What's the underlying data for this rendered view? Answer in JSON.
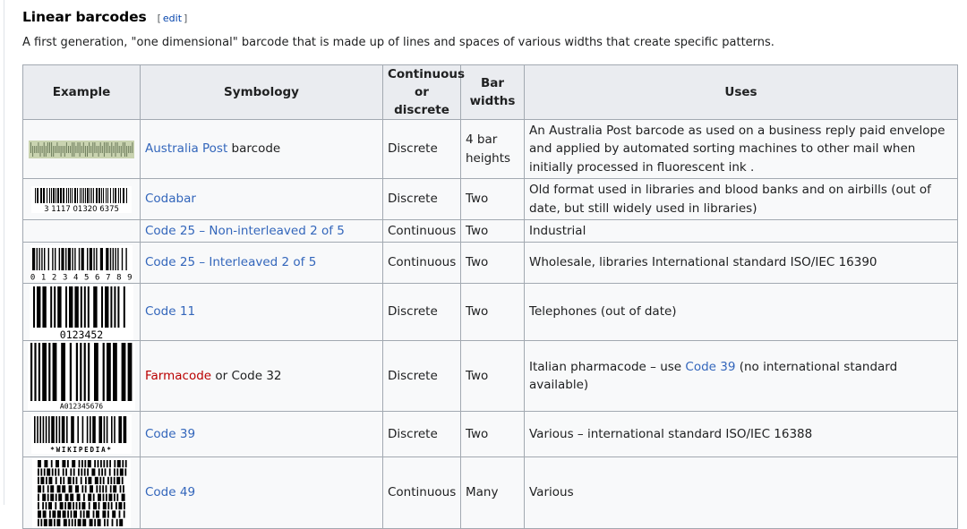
{
  "section": {
    "title": "Linear barcodes",
    "edit_open": "[",
    "edit_label": "edit",
    "edit_close": "]",
    "intro": "A first generation, \"one dimensional\" barcode that is made up of lines and spaces of various widths that create specific patterns."
  },
  "table": {
    "headers": {
      "example": "Example",
      "symbology": "Symbology",
      "continuous_1": "Continuous",
      "continuous_2": "or discrete",
      "bar_1": "Bar",
      "bar_2": "widths",
      "uses": "Uses"
    },
    "rows": [
      {
        "example_icon": "australia-post-barcode-image",
        "sym_link": "Australia Post",
        "sym_rest": " barcode",
        "type": "Discrete",
        "bar_1": "4 bar",
        "bar_2": "heights",
        "uses": "An Australia Post barcode as used on a business reply paid envelope and applied by automated sorting machines to other mail when initially processed in fluorescent ink ."
      },
      {
        "example_icon": "codabar-barcode-image",
        "example_text": "3 1117 01320 6375",
        "sym_link": "Codabar",
        "type": "Discrete",
        "bar": "Two",
        "uses": "Old format used in libraries and blood banks and on airbills (out of date, but still widely used in libraries)"
      },
      {
        "sym_link": "Code 25 – Non-interleaved 2 of 5",
        "type": "Continuous",
        "bar": "Two",
        "uses": "Industrial"
      },
      {
        "example_icon": "code-25-interleaved-barcode-image",
        "example_text": "0 1 2 3 4 5 6 7 8 9",
        "sym_link": "Code 25 – Interleaved 2 of 5",
        "type": "Continuous",
        "bar": "Two",
        "uses": "Wholesale, libraries International standard ISO/IEC 16390"
      },
      {
        "example_icon": "code-11-barcode-image",
        "example_text": "0123452",
        "sym_link": "Code 11",
        "type": "Discrete",
        "bar": "Two",
        "uses": "Telephones (out of date)"
      },
      {
        "example_icon": "farmacode-barcode-image",
        "example_text": "A012345676",
        "sym_link": "Farmacode",
        "sym_rest": " or Code 32",
        "type": "Discrete",
        "bar": "Two",
        "uses_pre": "Italian pharmacode – use ",
        "uses_link": "Code 39",
        "uses_post": " (no international standard available)"
      },
      {
        "example_icon": "code-39-barcode-image",
        "example_text": "*WIKIPEDIA*",
        "sym_link": "Code 39",
        "type": "Discrete",
        "bar": "Two",
        "uses": "Various – international standard ISO/IEC 16388"
      },
      {
        "example_icon": "code-49-barcode-image",
        "sym_link": "Code 49",
        "type": "Continuous",
        "bar": "Many",
        "uses": "Various"
      }
    ]
  },
  "colors": {
    "link": "#3366bb",
    "redlink": "#ba0000",
    "header_bg": "#eaecf0",
    "cell_bg": "#f8f9fa",
    "border": "#a2a9b1"
  }
}
